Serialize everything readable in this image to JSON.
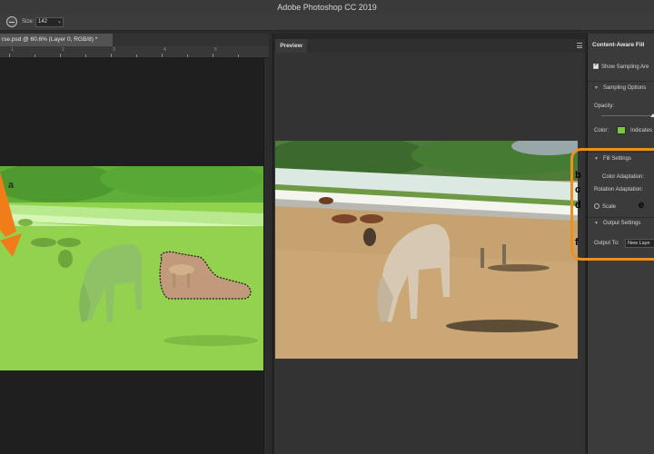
{
  "app": {
    "title": "Adobe Photoshop CC 2019"
  },
  "options_bar": {
    "brush_icon": "brush-size-icon",
    "size_label": "Size:",
    "size_value": "142"
  },
  "document": {
    "tab_title": "rse.psd @ 60.6% (Layer 0, RGB/8) *",
    "ruler_numbers": [
      "1",
      "2",
      "3",
      "4",
      "5"
    ]
  },
  "preview": {
    "tab_label": "Preview",
    "menu_icon": "panel-menu-icon"
  },
  "content_aware_fill": {
    "title": "Content-Aware Fill",
    "show_sampling_area": "Show Sampling Are",
    "sampling_options": "Sampling Options",
    "opacity_label": "Opacity:",
    "color_label": "Color:",
    "indicates_label": "Indicates",
    "sampling_color": "#7ac642",
    "fill_settings": "Fill Settings",
    "color_adaptation": "Color Adaptation:",
    "rotation_adaptation": "Rotation Adaptation:",
    "scale_label": "Scale",
    "output_settings": "Output Settings",
    "output_to_label": "Output To:",
    "output_to_value": "New Laye"
  },
  "annotations": {
    "a": "a",
    "b": "b",
    "c": "c",
    "d": "d",
    "e": "e",
    "f": "f",
    "highlight_color": "#f0901a"
  }
}
